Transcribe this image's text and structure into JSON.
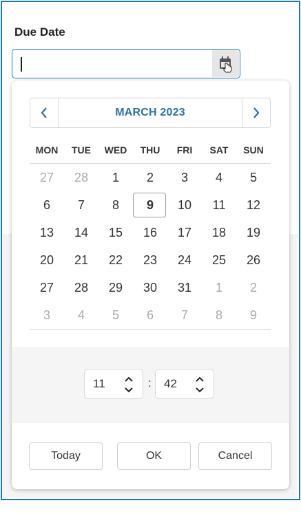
{
  "field": {
    "label": "Due Date",
    "value": ""
  },
  "calendar": {
    "month_label": "MARCH 2023",
    "weekdays": [
      "MON",
      "TUE",
      "WED",
      "THU",
      "FRI",
      "SAT",
      "SUN"
    ],
    "days": [
      {
        "d": "27",
        "other": true
      },
      {
        "d": "28",
        "other": true
      },
      {
        "d": "1"
      },
      {
        "d": "2"
      },
      {
        "d": "3"
      },
      {
        "d": "4"
      },
      {
        "d": "5"
      },
      {
        "d": "6"
      },
      {
        "d": "7"
      },
      {
        "d": "8"
      },
      {
        "d": "9",
        "today": true
      },
      {
        "d": "10"
      },
      {
        "d": "11"
      },
      {
        "d": "12"
      },
      {
        "d": "13"
      },
      {
        "d": "14"
      },
      {
        "d": "15"
      },
      {
        "d": "16"
      },
      {
        "d": "17"
      },
      {
        "d": "18"
      },
      {
        "d": "19"
      },
      {
        "d": "20"
      },
      {
        "d": "21"
      },
      {
        "d": "22"
      },
      {
        "d": "23"
      },
      {
        "d": "24"
      },
      {
        "d": "25"
      },
      {
        "d": "26"
      },
      {
        "d": "27"
      },
      {
        "d": "28"
      },
      {
        "d": "29"
      },
      {
        "d": "30"
      },
      {
        "d": "31"
      },
      {
        "d": "1",
        "other": true
      },
      {
        "d": "2",
        "other": true
      },
      {
        "d": "3",
        "other": true
      },
      {
        "d": "4",
        "other": true
      },
      {
        "d": "5",
        "other": true
      },
      {
        "d": "6",
        "other": true
      },
      {
        "d": "7",
        "other": true
      },
      {
        "d": "8",
        "other": true
      },
      {
        "d": "9",
        "other": true
      }
    ]
  },
  "time": {
    "hour": "11",
    "separator": ":",
    "minute": "42"
  },
  "buttons": {
    "today": "Today",
    "ok": "OK",
    "cancel": "Cancel"
  },
  "colors": {
    "accent": "#1f78b4",
    "month_text": "#2c6ea8",
    "other_month_text": "#aaaaaa"
  }
}
